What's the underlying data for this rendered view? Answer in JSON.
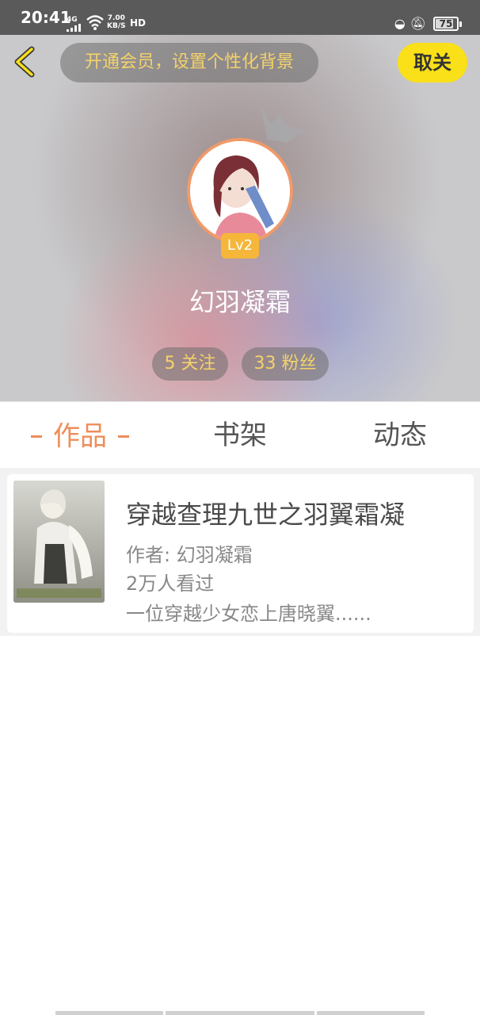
{
  "status_bar": {
    "time": "20:41",
    "network": "4G",
    "speed_value": "7.00",
    "speed_unit": "KB/S",
    "hd": "HD",
    "battery": "75",
    "icons": [
      "data-saver-icon",
      "mute-icon"
    ]
  },
  "header": {
    "vip_banner": "开通会员，设置个性化背景",
    "follow_button": "取关",
    "level": "Lv2",
    "username": "幻羽凝霜",
    "following_label": "5 关注",
    "fans_label": "33 粉丝"
  },
  "tabs": [
    {
      "label": "作品",
      "active": true
    },
    {
      "label": "书架",
      "active": false
    },
    {
      "label": "动态",
      "active": false
    }
  ],
  "books": [
    {
      "title": "穿越查理九世之羽翼霜凝",
      "author_label": "作者: 幻羽凝霜",
      "readers": "2万人看过",
      "description": "一位穿越少女恋上唐晓翼......"
    }
  ],
  "colors": {
    "accent": "#ef8d5a",
    "follow_button": "#f9e018",
    "pill_text": "#f4d26a",
    "level_badge": "#f5b63a"
  }
}
